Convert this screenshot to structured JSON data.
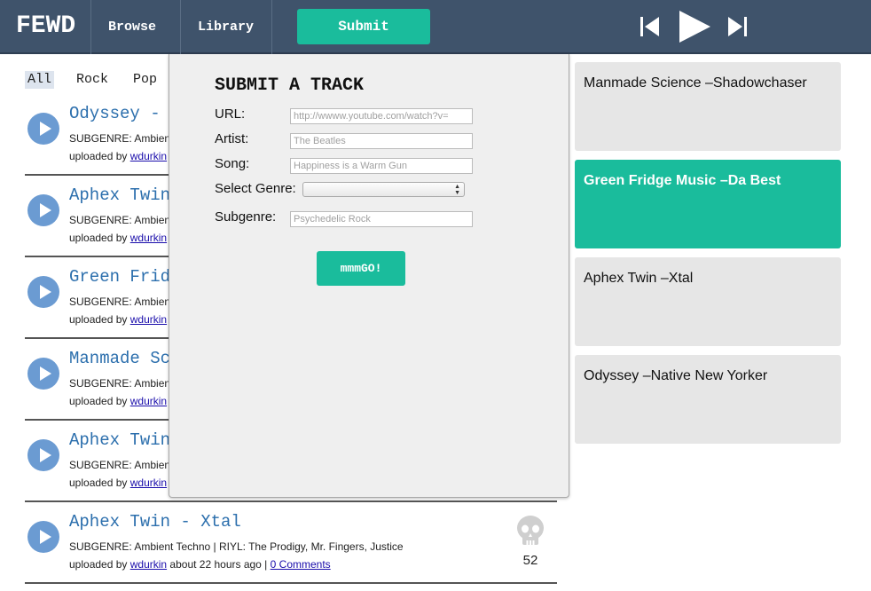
{
  "nav": {
    "logo": "FEWD",
    "browse": "Browse",
    "library": "Library",
    "submit": "Submit"
  },
  "genres": [
    "All",
    "Rock",
    "Pop"
  ],
  "tracks": [
    {
      "title": "Odyssey - N",
      "subgenre": "SUBGENRE: Ambient T",
      "uploaded_by_prefix": "uploaded by ",
      "user": "wdurkin"
    },
    {
      "title": "Aphex Twin",
      "subgenre": "SUBGENRE: Ambient T",
      "uploaded_by_prefix": "uploaded by ",
      "user": "wdurkin"
    },
    {
      "title": "Green Fridg",
      "subgenre": "SUBGENRE: Ambient T",
      "uploaded_by_prefix": "uploaded by ",
      "user": "wdurkin"
    },
    {
      "title": "Manmade Sc",
      "subgenre": "SUBGENRE: Ambient T",
      "uploaded_by_prefix": "uploaded by ",
      "user": "wdurkin"
    },
    {
      "title": "Aphex Twin",
      "subgenre": "SUBGENRE: Ambient T",
      "uploaded_by_prefix": "uploaded by ",
      "user": "wdurkin"
    },
    {
      "title": "Aphex Twin - Xtal",
      "subgenre": "SUBGENRE: Ambient Techno |   RIYL: The Prodigy, Mr. Fingers, Justice",
      "uploaded_by_prefix": "uploaded by ",
      "user": "wdurkin",
      "time": " about 22 hours ago | ",
      "comments": "0 Comments",
      "votes": "52"
    }
  ],
  "popup": {
    "title": "SUBMIT A TRACK",
    "url_label": "URL:",
    "url_placeholder": "http://wwww.youtube.com/watch?v=",
    "artist_label": "Artist:",
    "artist_placeholder": "The Beatles",
    "song_label": "Song:",
    "song_placeholder": "Happiness is a Warm Gun",
    "genre_label": "Select Genre:",
    "genre_value": "",
    "subgenre_label": "Subgenre:",
    "subgenre_placeholder": "Psychedelic Rock",
    "go_label": "mmmGO!"
  },
  "queue": [
    {
      "label": "Manmade Science –Shadowchaser",
      "active": false
    },
    {
      "label": "Green Fridge Music –Da Best",
      "active": true
    },
    {
      "label": "Aphex Twin –Xtal",
      "active": false
    },
    {
      "label": "Odyssey –Native New Yorker",
      "active": false
    }
  ],
  "colors": {
    "nav_bg": "#3f536b",
    "accent": "#1abc9c",
    "link_title": "#2c6fad",
    "play_circle": "#6b9bd2",
    "card_bg": "#e6e6e6"
  },
  "icons": {
    "prev": "skip-previous-icon",
    "play": "play-icon",
    "next": "skip-next-icon",
    "track_play": "play-circle-icon",
    "vote": "skull-icon"
  }
}
